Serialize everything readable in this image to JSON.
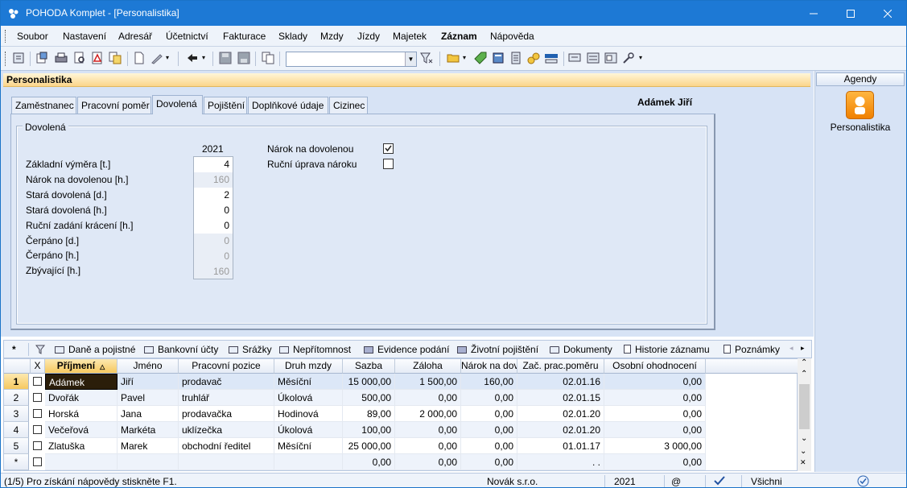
{
  "window": {
    "title": "POHODA Komplet - [Personalistika]"
  },
  "menu": [
    "Soubor",
    "Nastavení",
    "Adresář",
    "Účetnictví",
    "Fakturace",
    "Sklady",
    "Mzdy",
    "Jízdy",
    "Majetek",
    "Záznam",
    "Nápověda"
  ],
  "toolbar": {
    "combo_value": "",
    "icons": [
      "menu-icon",
      "export-icon",
      "print-icon",
      "preview-icon",
      "pdf-icon",
      "copy-doc-icon",
      "new-record-icon",
      "edit-tool-icon",
      "back-arrow-icon",
      "save-icon",
      "save-all-icon",
      "duplicate-icon",
      "filter-icon",
      "folder-icon",
      "tag-icon",
      "calculator-icon",
      "table-icon",
      "coins-icon",
      "iban-icon",
      "report-icon",
      "list-icon",
      "form-icon",
      "settings-icon"
    ]
  },
  "agenda": {
    "title": "Personalistika"
  },
  "tabs": [
    "Zaměstnanec",
    "Pracovní poměr",
    "Dovolená",
    "Pojištění",
    "Doplňkové údaje",
    "Cizinec"
  ],
  "active_tab": "Dovolená",
  "person_name": "Adámek Jiří",
  "vacation": {
    "group_label": "Dovolená",
    "year": "2021",
    "fields": [
      {
        "label": "Základní výměra [t.]",
        "value": "4",
        "enabled": true
      },
      {
        "label": "Nárok na dovolenou [h.]",
        "value": "160",
        "enabled": false
      },
      {
        "label": "Stará dovolená [d.]",
        "value": "2",
        "enabled": true
      },
      {
        "label": "Stará dovolená [h.]",
        "value": "0",
        "enabled": true
      },
      {
        "label": "Ruční zadání krácení [h.]",
        "value": "0",
        "enabled": true
      },
      {
        "label": "Čerpáno [d.]",
        "value": "0",
        "enabled": false
      },
      {
        "label": "Čerpáno [h.]",
        "value": "0",
        "enabled": false
      },
      {
        "label": "Zbývající [h.]",
        "value": "160",
        "enabled": false
      }
    ],
    "checks": [
      {
        "label": "Nárok na dovolenou",
        "checked": true
      },
      {
        "label": "Ruční úprava nároku",
        "checked": false
      }
    ]
  },
  "side": {
    "header": "Agendy",
    "item_label": "Personalistika"
  },
  "bottom_tabs": {
    "first": "*",
    "items": [
      "Daně a pojistné",
      "Bankovní účty",
      "Srážky",
      "Nepřítomnost",
      "Evidence podání",
      "Životní pojištění",
      "Dokumenty",
      "Historie záznamu",
      "Poznámky"
    ]
  },
  "grid": {
    "columns": [
      "X",
      "Příjmení",
      "Jméno",
      "Pracovní pozice",
      "Druh mzdy",
      "Sazba",
      "Záloha",
      "Nárok na dov",
      "Zač. prac.poměru",
      "Osobní ohodnocení"
    ],
    "rows": [
      {
        "n": "1",
        "surname": "Adámek",
        "name": "Jiří",
        "position": "prodavač",
        "wage": "Měsíční",
        "rate": "15 000,00",
        "advance": "1 500,00",
        "leave": "160,00",
        "start": "02.01.16",
        "bonus": "0,00"
      },
      {
        "n": "2",
        "surname": "Dvořák",
        "name": "Pavel",
        "position": "truhlář",
        "wage": "Úkolová",
        "rate": "500,00",
        "advance": "0,00",
        "leave": "0,00",
        "start": "02.01.15",
        "bonus": "0,00"
      },
      {
        "n": "3",
        "surname": "Horská",
        "name": "Jana",
        "position": "prodavačka",
        "wage": "Hodinová",
        "rate": "89,00",
        "advance": "2 000,00",
        "leave": "0,00",
        "start": "02.01.20",
        "bonus": "0,00"
      },
      {
        "n": "4",
        "surname": "Večeřová",
        "name": "Markéta",
        "position": "uklízečka",
        "wage": "Úkolová",
        "rate": "100,00",
        "advance": "0,00",
        "leave": "0,00",
        "start": "02.01.20",
        "bonus": "0,00"
      },
      {
        "n": "5",
        "surname": "Zlatuška",
        "name": "Marek",
        "position": "obchodní ředitel",
        "wage": "Měsíční",
        "rate": "25 000,00",
        "advance": "0,00",
        "leave": "0,00",
        "start": "01.01.17",
        "bonus": "3 000,00"
      },
      {
        "n": "*",
        "surname": "",
        "name": "",
        "position": "",
        "wage": "",
        "rate": "0,00",
        "advance": "0,00",
        "leave": "0,00",
        "start": ". .",
        "bonus": "0,00"
      }
    ]
  },
  "status": {
    "help": "(1/5) Pro získání nápovědy stiskněte F1.",
    "company": "Novák s.r.o.",
    "year": "2021",
    "at": "@",
    "filter": "Všichni"
  }
}
